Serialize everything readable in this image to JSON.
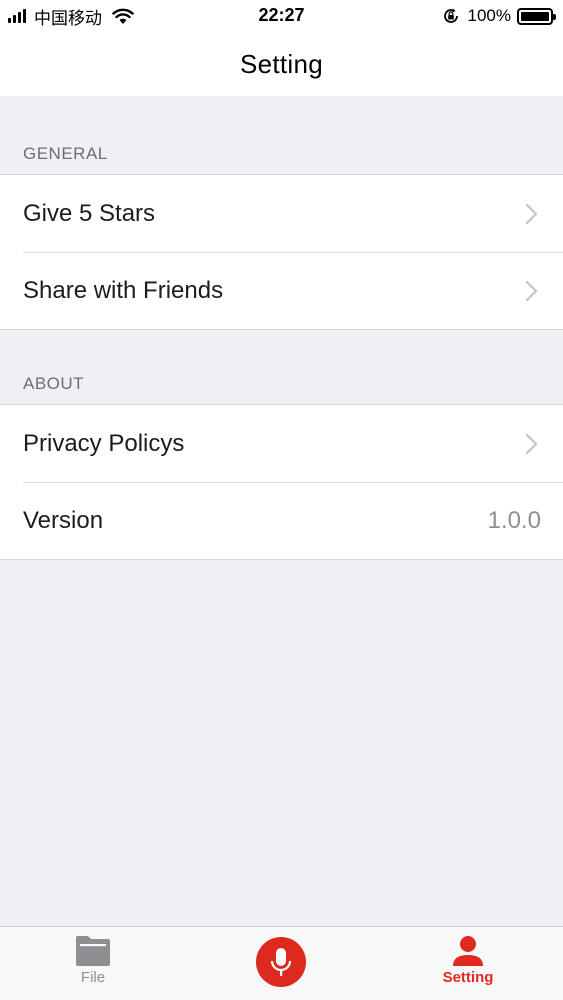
{
  "status_bar": {
    "carrier": "中国移动",
    "time": "22:27",
    "battery_percent": "100%",
    "battery_level": 1.0,
    "icons": [
      "signal-icon",
      "wifi-icon",
      "rotation-lock-icon",
      "battery-icon"
    ]
  },
  "nav": {
    "title": "Setting"
  },
  "sections": [
    {
      "header": "GENERAL",
      "rows": [
        {
          "label": "Give 5 Stars",
          "accessory": "chevron-right-icon"
        },
        {
          "label": "Share with Friends",
          "accessory": "chevron-right-icon"
        }
      ]
    },
    {
      "header": "ABOUT",
      "rows": [
        {
          "label": "Privacy Policys",
          "accessory": "chevron-right-icon"
        },
        {
          "label": "Version",
          "value": "1.0.0"
        }
      ]
    }
  ],
  "tab_bar": {
    "tabs": [
      {
        "label": "File",
        "icon": "folder-icon",
        "selected": false
      },
      {
        "label": "Setting",
        "icon": "person-icon",
        "selected": true
      }
    ],
    "center_button_icon": "microphone-icon"
  },
  "colors": {
    "accent": "#dd2a1e",
    "background": "#efeff4",
    "section_header_text": "#6d6d72",
    "secondary_text": "#8e8e93"
  }
}
